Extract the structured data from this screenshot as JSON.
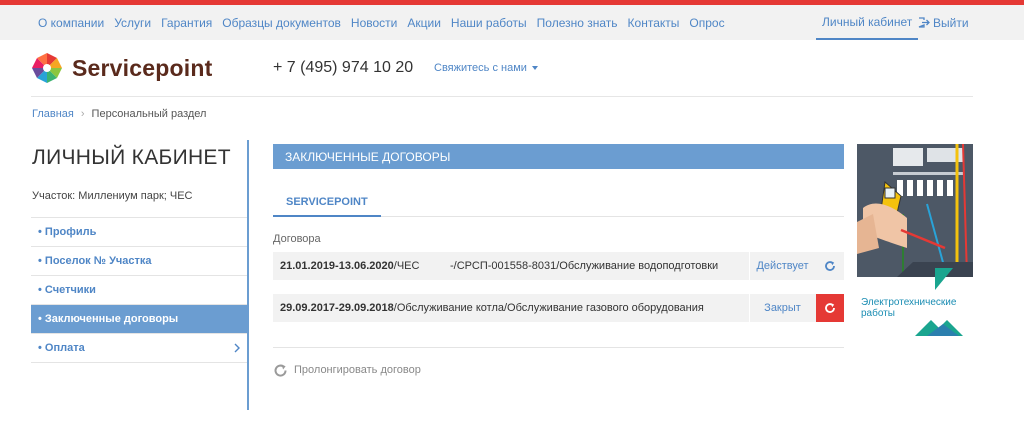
{
  "topnav": {
    "items": [
      "О компании",
      "Услуги",
      "Гарантия",
      "Образцы документов",
      "Новости",
      "Акции",
      "Наши работы",
      "Полезно знать",
      "Контакты",
      "Опрос"
    ],
    "cabinet": "Личный кабинет",
    "logout": "Выйти"
  },
  "header": {
    "brand": "Servicepoint",
    "phone": "+ 7 (495) 974 10 20",
    "contact": "Свяжитесь с нами"
  },
  "breadcrumb": {
    "home": "Главная",
    "current": "Персональный раздел"
  },
  "sidebar": {
    "title": "ЛИЧНЫЙ КАБИНЕТ",
    "member": "Участок: Миллениум парк; ЧЕС",
    "items": [
      {
        "label": "• Профиль"
      },
      {
        "label": "• Поселок № Участка"
      },
      {
        "label": "• Счетчики"
      },
      {
        "label": "• Заключенные договоры"
      },
      {
        "label": "• Оплата"
      }
    ]
  },
  "main": {
    "banner": "ЗАКЛЮЧЕННЫЕ ДОГОВОРЫ",
    "tab": "SERVICEPOINT",
    "contracts_label": "Договора",
    "contracts": [
      {
        "dates": "21.01.2019-13.06.2020",
        "desc": "/ЧЕС          -/СРСП-001558-8031/Обслуживание водоподготовки",
        "status": "Действует"
      },
      {
        "dates": "29.09.2017-29.09.2018",
        "desc": "/Обслуживание котла/Обслуживание газового оборудования",
        "status": "Закрыт"
      }
    ],
    "prolong": "Пролонгировать договор"
  },
  "ad": {
    "caption": "Электротехнические работы"
  },
  "colors": {
    "accent": "#6b9dd1",
    "link": "#4f86c6",
    "danger": "#e53935",
    "brand": "#5a2a1c"
  },
  "icons": [
    "logout-icon",
    "logo-icon",
    "chevron-right-icon",
    "refresh-icon"
  ]
}
